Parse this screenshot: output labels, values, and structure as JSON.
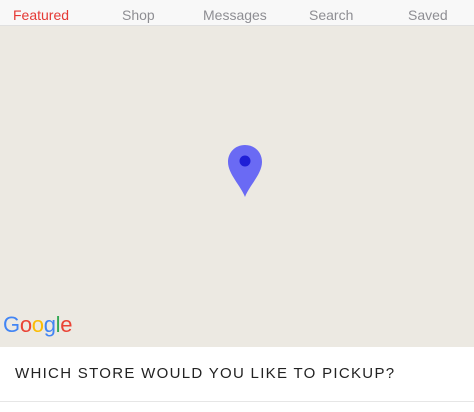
{
  "tabs": {
    "featured": "Featured",
    "shop": "Shop",
    "messages": "Messages",
    "search": "Search",
    "saved": "Saved"
  },
  "map": {
    "logo_letters": [
      "G",
      "o",
      "o",
      "g",
      "l",
      "e"
    ],
    "logo_colors": [
      "#4285F4",
      "#EA4335",
      "#FBBC05",
      "#4285F4",
      "#34A853",
      "#EA4335"
    ],
    "pin_color": "#6a6af4",
    "pin_dot_color": "#1f1fd6",
    "background_color": "#ece9e2"
  },
  "footer": {
    "prompt": "WHICH STORE WOULD YOU LIKE TO PICKUP?"
  },
  "colors": {
    "active_tab": "#e53935",
    "inactive_tab": "#8e8e93"
  }
}
